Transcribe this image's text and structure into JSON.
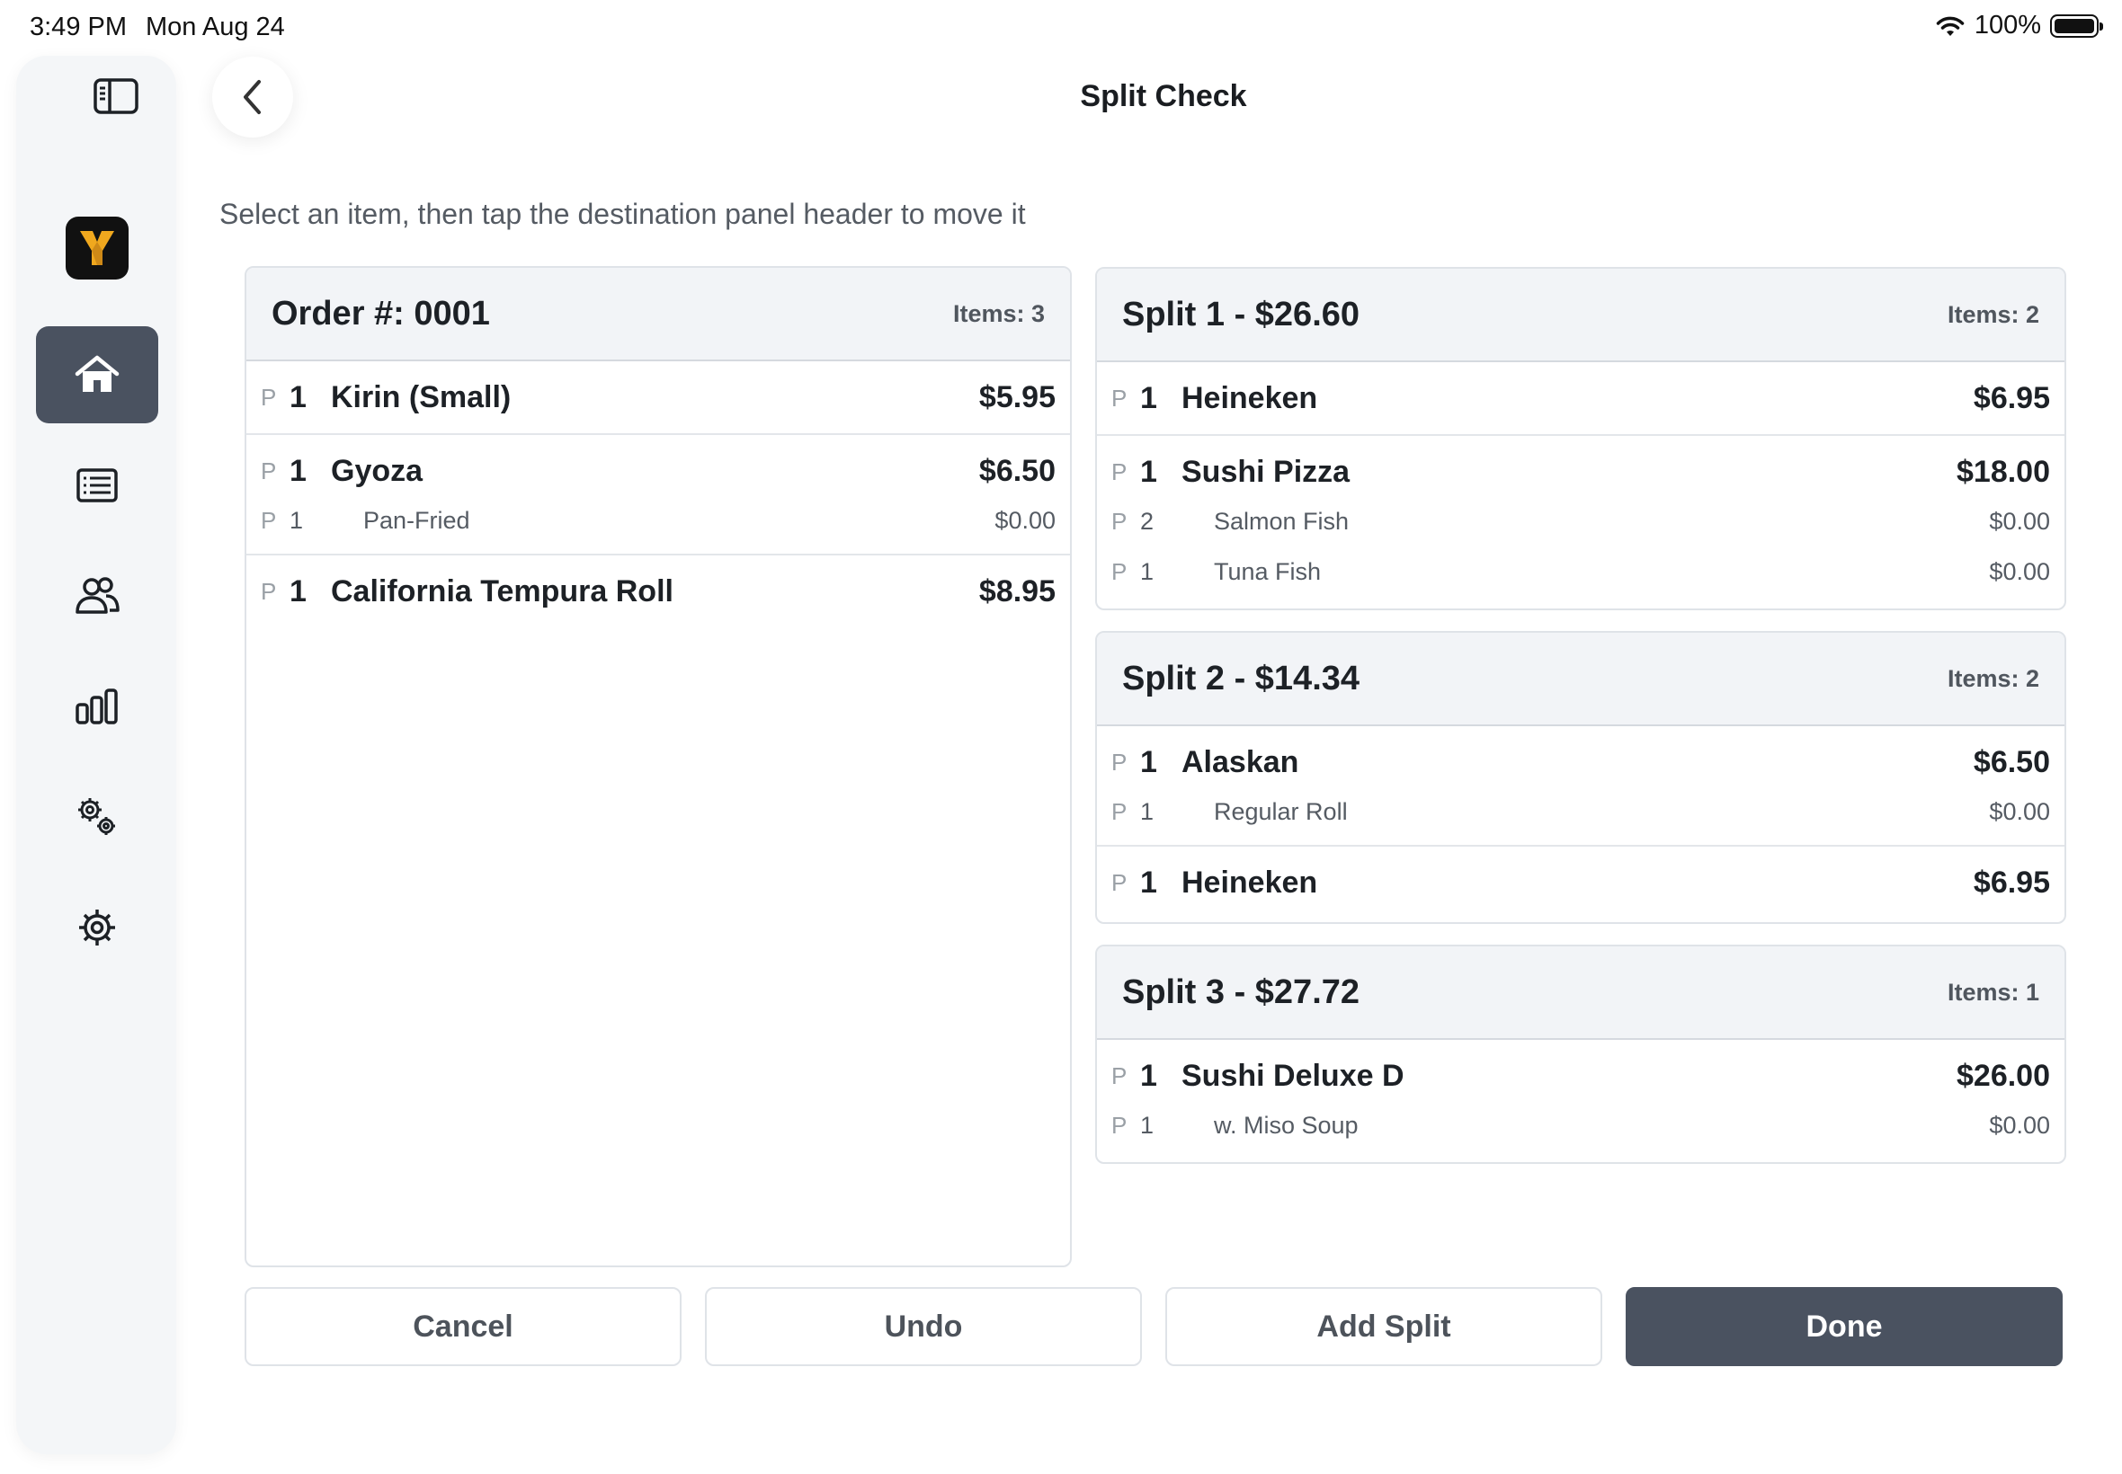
{
  "status_bar": {
    "time": "3:49 PM",
    "date": "Mon Aug 24",
    "battery": "100%"
  },
  "sidebar": {
    "logo_letter": "Y",
    "items": [
      {
        "icon": "home-icon",
        "active": true
      },
      {
        "icon": "orders-list-icon",
        "active": false
      },
      {
        "icon": "customers-icon",
        "active": false
      },
      {
        "icon": "reports-chart-icon",
        "active": false
      },
      {
        "icon": "advanced-settings-icon",
        "active": false
      },
      {
        "icon": "settings-icon",
        "active": false
      }
    ]
  },
  "header": {
    "title": "Split Check"
  },
  "instruction": "Select an item, then tap the destination panel header to move it",
  "order": {
    "title": "Order #: 0001",
    "count": "Items: 3",
    "items": [
      {
        "p": "P",
        "qty": "1",
        "name": "Kirin (Small)",
        "price": "$5.95",
        "mods": []
      },
      {
        "p": "P",
        "qty": "1",
        "name": "Gyoza",
        "price": "$6.50",
        "mods": [
          {
            "p": "P",
            "qty": "1",
            "name": "Pan-Fried",
            "price": "$0.00"
          }
        ]
      },
      {
        "p": "P",
        "qty": "1",
        "name": "California Tempura Roll",
        "price": "$8.95",
        "mods": []
      }
    ]
  },
  "splits": [
    {
      "title": "Split 1 - $26.60",
      "count": "Items: 2",
      "items": [
        {
          "p": "P",
          "qty": "1",
          "name": "Heineken",
          "price": "$6.95",
          "mods": []
        },
        {
          "p": "P",
          "qty": "1",
          "name": "Sushi Pizza",
          "price": "$18.00",
          "mods": [
            {
              "p": "P",
              "qty": "2",
              "name": "Salmon Fish",
              "price": "$0.00"
            },
            {
              "p": "P",
              "qty": "1",
              "name": "Tuna Fish",
              "price": "$0.00"
            }
          ]
        }
      ]
    },
    {
      "title": "Split 2 - $14.34",
      "count": "Items: 2",
      "items": [
        {
          "p": "P",
          "qty": "1",
          "name": "Alaskan",
          "price": "$6.50",
          "mods": [
            {
              "p": "P",
              "qty": "1",
              "name": "Regular Roll",
              "price": "$0.00"
            }
          ]
        },
        {
          "p": "P",
          "qty": "1",
          "name": "Heineken",
          "price": "$6.95",
          "mods": []
        }
      ]
    },
    {
      "title": "Split 3 - $27.72",
      "count": "Items: 1",
      "items": [
        {
          "p": "P",
          "qty": "1",
          "name": "Sushi Deluxe D",
          "price": "$26.00",
          "mods": [
            {
              "p": "P",
              "qty": "1",
              "name": "w. Miso Soup",
              "price": "$0.00"
            }
          ]
        }
      ]
    }
  ],
  "buttons": {
    "cancel": "Cancel",
    "undo": "Undo",
    "add_split": "Add Split",
    "done": "Done"
  },
  "colors": {
    "primary": "#4a5260",
    "header_bg": "#f2f4f7",
    "border": "#dfe3e8",
    "logo_gold": "#f0a81e"
  }
}
